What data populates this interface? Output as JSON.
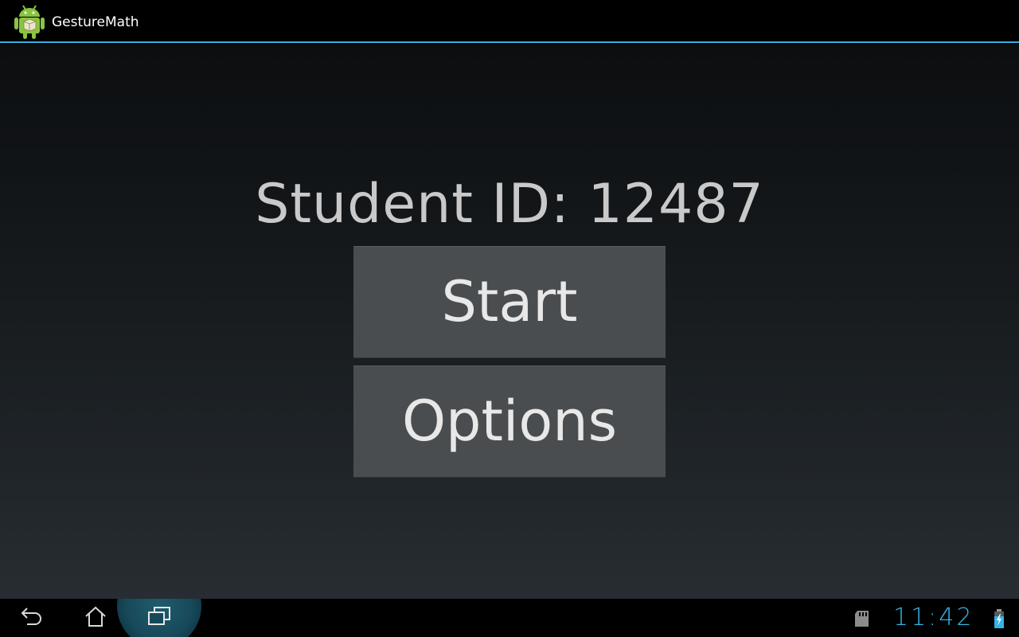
{
  "action_bar": {
    "title": "GestureMath",
    "icon": "android-robot-icon",
    "accent_color": "#33b5e5"
  },
  "main": {
    "student_id_text": "Student ID: 12487",
    "start_label": "Start",
    "options_label": "Options"
  },
  "nav_bar": {
    "back_icon": "back-icon",
    "home_icon": "home-icon",
    "recents_icon": "recent-apps-icon",
    "sd_icon": "sd-card-icon",
    "clock": "11:42",
    "battery_icon": "battery-charging-icon"
  }
}
